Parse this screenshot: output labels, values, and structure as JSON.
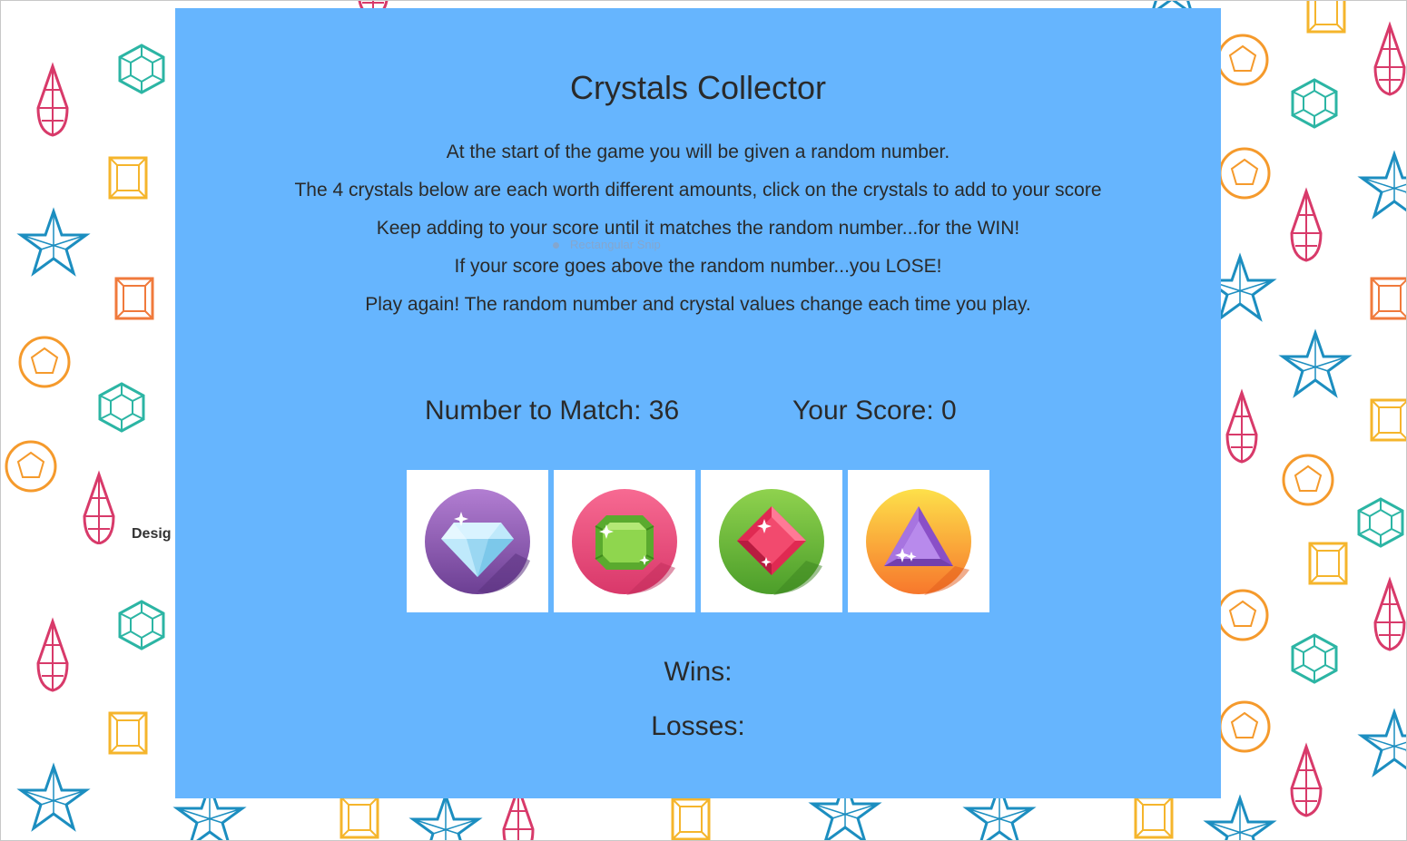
{
  "page": {
    "title": "Crystals Collector",
    "background_label": "Desig",
    "ghost_tooltip": "Rectangular Snip"
  },
  "instructions": [
    "At the start of the game you will be given a random number.",
    "The 4 crystals below are each worth different amounts, click on the crystals to add to your score",
    "Keep adding to your score until it matches the random number...for the WIN!",
    "If your score goes above the random number...you LOSE!",
    "Play again! The random number and crystal values change each time you play."
  ],
  "scoreboard": {
    "target_label": "Number to Match: 36",
    "score_label": "Your Score: 0",
    "target_value": 36,
    "score_value": 0
  },
  "crystals": [
    {
      "icon": "diamond-crystal-icon",
      "circle_color": "#7d52a8",
      "gem_color": "#bfe9fb"
    },
    {
      "icon": "emerald-crystal-icon",
      "circle_color": "#ec4f7e",
      "gem_color": "#6cc13a"
    },
    {
      "icon": "ruby-crystal-icon",
      "circle_color": "#64b33a",
      "gem_color": "#e63258"
    },
    {
      "icon": "amethyst-crystal-icon",
      "circle_color": "#f7a02c",
      "gem_color": "#a066d8"
    }
  ],
  "stats": {
    "wins_label": "Wins:",
    "losses_label": "Losses:"
  },
  "colors": {
    "panel": "#66b5fe",
    "text": "#2a2a2a"
  }
}
